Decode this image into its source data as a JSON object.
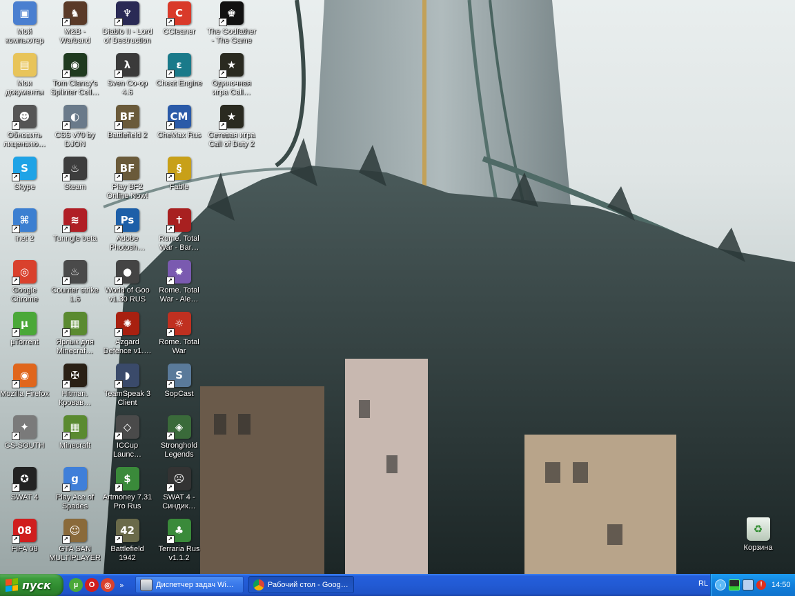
{
  "desktop": {
    "icons": [
      {
        "label": "Мой компьютер",
        "icon": "computer-icon",
        "color": "#4a7fd0",
        "glyph": "▣",
        "shortcut": false
      },
      {
        "label": "Мои документы",
        "icon": "documents-folder-icon",
        "color": "#e8c45a",
        "glyph": "▤",
        "shortcut": false
      },
      {
        "label": "Обновить лицензию…",
        "icon": "license-update-icon",
        "color": "#555555",
        "glyph": "☻",
        "shortcut": true
      },
      {
        "label": "Skype",
        "icon": "skype-icon",
        "color": "#1fa3e6",
        "glyph": "S",
        "shortcut": true
      },
      {
        "label": "inet 2",
        "icon": "network-icon",
        "color": "#3c7fd1",
        "glyph": "⌘",
        "shortcut": true
      },
      {
        "label": "Google Chrome",
        "icon": "chrome-icon",
        "color": "#d9412d",
        "glyph": "◎",
        "shortcut": true
      },
      {
        "label": "µTorrent",
        "icon": "utorrent-icon",
        "color": "#4aa838",
        "glyph": "µ",
        "shortcut": true
      },
      {
        "label": "Mozilla Firefox",
        "icon": "firefox-icon",
        "color": "#e0661c",
        "glyph": "◉",
        "shortcut": true
      },
      {
        "label": "CS-SOUTH",
        "icon": "counter-strike-icon",
        "color": "#7a7a7a",
        "glyph": "✦",
        "shortcut": true
      },
      {
        "label": "SWAT 4",
        "icon": "swat4-icon",
        "color": "#222222",
        "glyph": "✪",
        "shortcut": true
      },
      {
        "label": "FIFA 08",
        "icon": "fifa08-icon",
        "color": "#d01e1e",
        "glyph": "08",
        "shortcut": true
      },
      {
        "label": "M&B - Warband",
        "icon": "warband-icon",
        "color": "#5a3a28",
        "glyph": "♞",
        "shortcut": true
      },
      {
        "label": "Tom Clancy's Splinter Cell…",
        "icon": "splinter-cell-icon",
        "color": "#1f3a1f",
        "glyph": "◉",
        "shortcut": true
      },
      {
        "label": "CSS v70 by DJON",
        "icon": "css-icon",
        "color": "#6a7a8a",
        "glyph": "◐",
        "shortcut": true
      },
      {
        "label": "Steam",
        "icon": "steam-icon",
        "color": "#3d3d3d",
        "glyph": "♨",
        "shortcut": true
      },
      {
        "label": "Tunngle beta",
        "icon": "tunngle-icon",
        "color": "#b01e25",
        "glyph": "≋",
        "shortcut": true
      },
      {
        "label": "Counter strike 1.6",
        "icon": "steam-icon",
        "color": "#4a4a4a",
        "glyph": "♨",
        "shortcut": true
      },
      {
        "label": "Ярлык для Minecraf…",
        "icon": "minecraft-icon",
        "color": "#5a8a30",
        "glyph": "▦",
        "shortcut": true
      },
      {
        "label": "Hitman. Кровав…",
        "icon": "hitman-icon",
        "color": "#2a2015",
        "glyph": "✠",
        "shortcut": true
      },
      {
        "label": "Minecraft",
        "icon": "minecraft-icon",
        "color": "#5a8a30",
        "glyph": "▦",
        "shortcut": true
      },
      {
        "label": "Play Ace of Spades",
        "icon": "ace-of-spades-icon",
        "color": "#3f7fd9",
        "glyph": "g",
        "shortcut": true
      },
      {
        "label": "GTA SAN MULTIPLAYER",
        "icon": "gta-sa-icon",
        "color": "#8a6a3a",
        "glyph": "☺",
        "shortcut": true
      },
      {
        "label": "Diablo II - Lord of Destruction",
        "icon": "diablo2-icon",
        "color": "#2a2a55",
        "glyph": "♆",
        "shortcut": true
      },
      {
        "label": "Sven Co-op 4.6",
        "icon": "half-life-icon",
        "color": "#3a3a3a",
        "glyph": "λ",
        "shortcut": true
      },
      {
        "label": "Battlefield 2",
        "icon": "battlefield-icon",
        "color": "#6a5a3a",
        "glyph": "BF",
        "shortcut": true
      },
      {
        "label": "Play BF2 Online Now!",
        "icon": "battlefield-icon",
        "color": "#6a5a3a",
        "glyph": "BF",
        "shortcut": true
      },
      {
        "label": "Adobe Photosh…",
        "icon": "photoshop-icon",
        "color": "#1d5fa8",
        "glyph": "Ps",
        "shortcut": true
      },
      {
        "label": "World of Goo v1.30 RUS",
        "icon": "world-of-goo-icon",
        "color": "#444444",
        "glyph": "●",
        "shortcut": true
      },
      {
        "label": "Azgard Defence v1.…",
        "icon": "azgard-icon",
        "color": "#a82010",
        "glyph": "✺",
        "shortcut": true
      },
      {
        "label": "TeamSpeak 3 Client",
        "icon": "teamspeak-icon",
        "color": "#3a4a6a",
        "glyph": "◗",
        "shortcut": true
      },
      {
        "label": "ICCup Launc…",
        "icon": "iccup-icon",
        "color": "#4a4a4a",
        "glyph": "◇",
        "shortcut": true
      },
      {
        "label": "Artmoney 7.31 Pro Rus",
        "icon": "artmoney-icon",
        "color": "#3a8a3a",
        "glyph": "$",
        "shortcut": true
      },
      {
        "label": "Battlefield 1942",
        "icon": "battlefield-1942-icon",
        "color": "#6a6a4a",
        "glyph": "42",
        "shortcut": true
      },
      {
        "label": "CCleaner",
        "icon": "ccleaner-icon",
        "color": "#d93a2a",
        "glyph": "C",
        "shortcut": true
      },
      {
        "label": "Cheat Engine",
        "icon": "cheat-engine-icon",
        "color": "#1a7a8a",
        "glyph": "ε",
        "shortcut": true
      },
      {
        "label": "CheMax Rus",
        "icon": "chemax-icon",
        "color": "#2a5aa8",
        "glyph": "CM",
        "shortcut": true
      },
      {
        "label": "Fable",
        "icon": "fable-icon",
        "color": "#c8a018",
        "glyph": "§",
        "shortcut": true
      },
      {
        "label": "Rome. Total War - Bar…",
        "icon": "rome-total-war-icon",
        "color": "#a82020",
        "glyph": "✝",
        "shortcut": true
      },
      {
        "label": "Rome. Total War - Ale…",
        "icon": "rome-total-war-icon",
        "color": "#7a5ab0",
        "glyph": "✹",
        "shortcut": true
      },
      {
        "label": "Rome. Total War",
        "icon": "rome-total-war-icon",
        "color": "#c03020",
        "glyph": "☼",
        "shortcut": true
      },
      {
        "label": "SopCast",
        "icon": "sopcast-icon",
        "color": "#5a7a9a",
        "glyph": "S",
        "shortcut": true
      },
      {
        "label": "Stronghold Legends",
        "icon": "stronghold-icon",
        "color": "#3a6a3a",
        "glyph": "◈",
        "shortcut": true
      },
      {
        "label": "SWAT 4 - Синдик…",
        "icon": "swat4-syndicate-icon",
        "color": "#333333",
        "glyph": "☹",
        "shortcut": true
      },
      {
        "label": "Terraria Rus v1.1.2",
        "icon": "terraria-icon",
        "color": "#3a8a3a",
        "glyph": "♣",
        "shortcut": true
      },
      {
        "label": "The Godfather - The Game",
        "icon": "godfather-icon",
        "color": "#111111",
        "glyph": "♚",
        "shortcut": true
      },
      {
        "label": "Одиночная игра Call…",
        "icon": "call-of-duty-2-icon",
        "color": "#2a2a20",
        "glyph": "★",
        "shortcut": true
      },
      {
        "label": "Сетевая игра Call of Duty 2",
        "icon": "call-of-duty-2-icon",
        "color": "#2a2a20",
        "glyph": "★",
        "shortcut": true
      }
    ],
    "recycle_bin": {
      "label": "Корзина",
      "icon": "recycle-bin-icon"
    }
  },
  "taskbar": {
    "start_label": "пуск",
    "quick_launch": [
      {
        "icon": "utorrent-icon",
        "color": "#4aa838",
        "glyph": "µ"
      },
      {
        "icon": "opera-icon",
        "color": "#d01e1e",
        "glyph": "O"
      },
      {
        "icon": "chrome-icon",
        "color": "#d9412d",
        "glyph": "◎"
      }
    ],
    "quick_launch_more": "»",
    "tasks": [
      {
        "label": "Диспетчер задач Wi…",
        "icon": "task-manager-icon",
        "active": false
      },
      {
        "label": "Рабочий стол - Goog…",
        "icon": "chrome-icon",
        "active": true
      }
    ],
    "tray": {
      "language": "RL",
      "time": "14:50",
      "icons": [
        "network-status-icon",
        "display-icon",
        "security-alert-icon"
      ]
    }
  }
}
